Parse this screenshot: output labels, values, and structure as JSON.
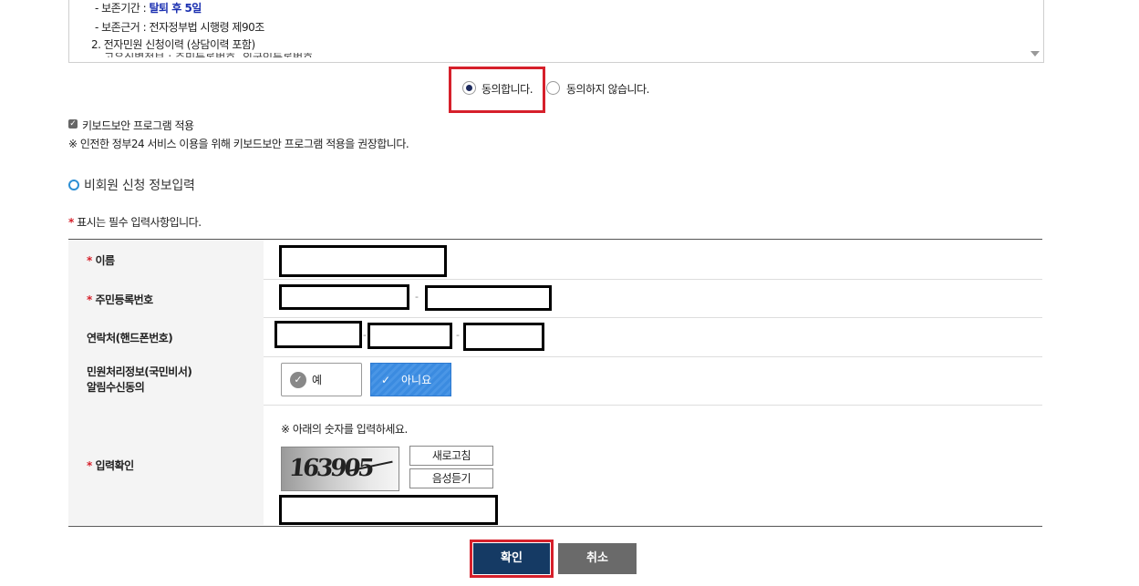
{
  "terms": {
    "line1_prefix": "- 보존기간 : ",
    "line1_highlight": "탈퇴 후 5일",
    "line2": "- 보존근거 : 전자정부법 시행령 제90조",
    "line3": "2. 전자민원 신청이력 (상담이력 포함)",
    "line4_cut": "- 고유식별정보 : 주민등록번호, 외국인등록번호"
  },
  "consent": {
    "agree_label": "동의합니다.",
    "disagree_label": "동의하지 않습니다.",
    "selected": "agree"
  },
  "keyboard": {
    "checkbox_label": "키보드보안 프로그램 적용",
    "notice": "※ 인전한 정부24 서비스 이용을 위해 키보드보안 프로그램 적용을 권장합니다."
  },
  "section": {
    "title": "비회원 신청 정보입력",
    "required_mark": "*",
    "required_note": " 표시는 필수 입력사항입니다."
  },
  "form": {
    "name_label": "이름",
    "rrn_label": "주민등록번호",
    "rrn_sep": "-",
    "phone_label": "연락처(핸드폰번호)",
    "phone_sep1": "-",
    "phone_sep2": "-",
    "notify_label_line1": "민원처리정보(국민비서)",
    "notify_label_line2": "알림수신동의",
    "notify_yes": "예",
    "notify_no": "아니요",
    "notify_selected": "no",
    "captcha_label": "입력확인",
    "captcha_hint": "※ 아래의 숫자를 입력하세요.",
    "captcha_value": "163905",
    "refresh_label": "새로고침",
    "audio_label": "음성듣기"
  },
  "buttons": {
    "confirm": "확인",
    "cancel": "취소"
  },
  "colors": {
    "highlight_red": "#d6202b",
    "confirm_navy": "#153a64",
    "no_button_blue": "#3b8be0"
  }
}
